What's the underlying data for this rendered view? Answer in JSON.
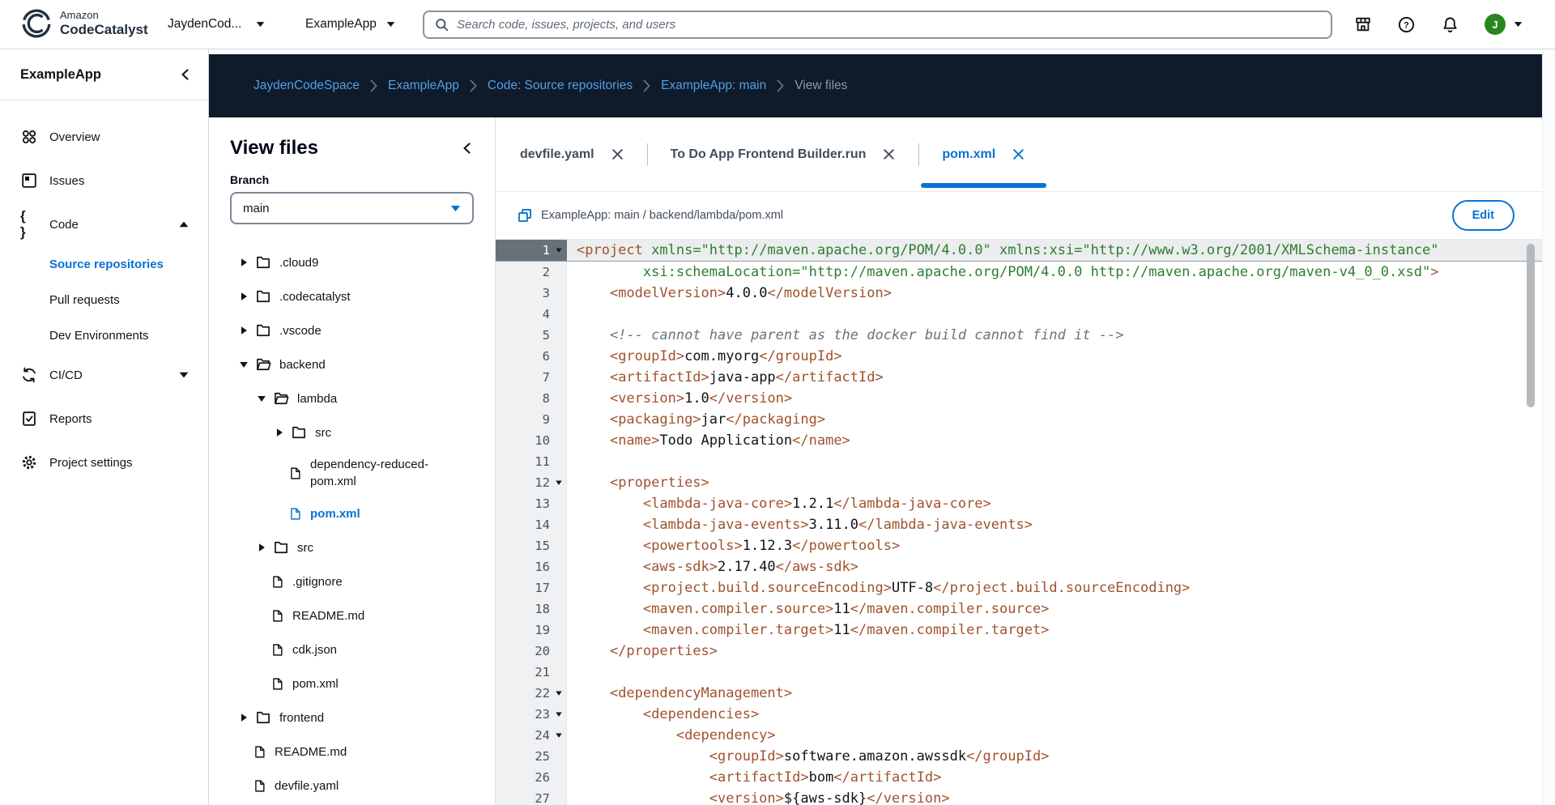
{
  "topbar": {
    "brand_small": "Amazon",
    "brand_bold": "CodeCatalyst",
    "space_selector": "JaydenCod...",
    "project_selector": "ExampleApp",
    "search_placeholder": "Search code, issues, projects, and users",
    "avatar_initial": "J"
  },
  "breadcrumb": {
    "links": [
      "JaydenCodeSpace",
      "ExampleApp",
      "Code: Source repositories",
      "ExampleApp: main"
    ],
    "current": "View files"
  },
  "sidebar": {
    "project_name": "ExampleApp",
    "items": [
      {
        "label": "Overview",
        "icon": "overview"
      },
      {
        "label": "Issues",
        "icon": "issues"
      },
      {
        "label": "Code",
        "icon": "code",
        "caret": "up"
      },
      {
        "label": "Source repositories",
        "sub": true,
        "active": true
      },
      {
        "label": "Pull requests",
        "sub": true
      },
      {
        "label": "Dev Environments",
        "sub": true
      },
      {
        "label": "CI/CD",
        "icon": "cicd",
        "caret": "down"
      },
      {
        "label": "Reports",
        "icon": "reports"
      },
      {
        "label": "Project settings",
        "icon": "settings"
      }
    ]
  },
  "file_tree": {
    "title": "View files",
    "branch_label": "Branch",
    "branch_value": "main",
    "items": [
      {
        "name": ".cloud9",
        "kind": "folder",
        "depth": 0
      },
      {
        "name": ".codecatalyst",
        "kind": "folder",
        "depth": 0
      },
      {
        "name": ".vscode",
        "kind": "folder",
        "depth": 0
      },
      {
        "name": "backend",
        "kind": "folder-open",
        "depth": 0
      },
      {
        "name": "lambda",
        "kind": "folder-open",
        "depth": 1
      },
      {
        "name": "src",
        "kind": "folder",
        "depth": 2
      },
      {
        "name": "dependency-reduced-pom.xml",
        "kind": "file",
        "depth": 2,
        "wrapped": true
      },
      {
        "name": "pom.xml",
        "kind": "file",
        "depth": 2,
        "selected": true
      },
      {
        "name": "src",
        "kind": "folder",
        "depth": 1
      },
      {
        "name": ".gitignore",
        "kind": "file",
        "depth": 1
      },
      {
        "name": "README.md",
        "kind": "file",
        "depth": 1
      },
      {
        "name": "cdk.json",
        "kind": "file",
        "depth": 1
      },
      {
        "name": "pom.xml",
        "kind": "file",
        "depth": 1
      },
      {
        "name": "frontend",
        "kind": "folder",
        "depth": 0
      },
      {
        "name": "README.md",
        "kind": "file",
        "depth": 0
      },
      {
        "name": "devfile.yaml",
        "kind": "file",
        "depth": 0
      }
    ]
  },
  "tabs": [
    {
      "label": "devfile.yaml",
      "active": false
    },
    {
      "label": "To Do App Frontend Builder.run",
      "active": false
    },
    {
      "label": "pom.xml",
      "active": true
    }
  ],
  "pathbar": {
    "path": "ExampleApp: main / backend/lambda/pom.xml",
    "edit_label": "Edit"
  },
  "editor": {
    "lines": [
      {
        "num": 1,
        "fold": true,
        "active": true,
        "tokens": [
          [
            "tag",
            "<project"
          ],
          [
            "txt",
            " "
          ],
          [
            "attr",
            "xmlns="
          ],
          [
            "str",
            "\"http://maven.apache.org/POM/4.0.0\""
          ],
          [
            "txt",
            " "
          ],
          [
            "attr",
            "xmlns:xsi="
          ],
          [
            "str",
            "\"http://www.w3.org/2001/XMLSchema-instance\""
          ]
        ]
      },
      {
        "num": 2,
        "tokens": [
          [
            "txt",
            "        "
          ],
          [
            "attr",
            "xsi:schemaLocation="
          ],
          [
            "str",
            "\"http://maven.apache.org/POM/4.0.0 http://maven.apache.org/maven-v4_0_0.xsd\""
          ],
          [
            "tag",
            ">"
          ]
        ]
      },
      {
        "num": 3,
        "tokens": [
          [
            "txt",
            "    "
          ],
          [
            "tag",
            "<modelVersion>"
          ],
          [
            "txt",
            "4.0.0"
          ],
          [
            "tag",
            "</modelVersion>"
          ]
        ]
      },
      {
        "num": 4,
        "tokens": []
      },
      {
        "num": 5,
        "tokens": [
          [
            "txt",
            "    "
          ],
          [
            "com",
            "<!-- cannot have parent as the docker build cannot find it -->"
          ]
        ]
      },
      {
        "num": 6,
        "tokens": [
          [
            "txt",
            "    "
          ],
          [
            "tag",
            "<groupId>"
          ],
          [
            "txt",
            "com.myorg"
          ],
          [
            "tag",
            "</groupId>"
          ]
        ]
      },
      {
        "num": 7,
        "tokens": [
          [
            "txt",
            "    "
          ],
          [
            "tag",
            "<artifactId>"
          ],
          [
            "txt",
            "java-app"
          ],
          [
            "tag",
            "</artifactId>"
          ]
        ]
      },
      {
        "num": 8,
        "tokens": [
          [
            "txt",
            "    "
          ],
          [
            "tag",
            "<version>"
          ],
          [
            "txt",
            "1.0"
          ],
          [
            "tag",
            "</version>"
          ]
        ]
      },
      {
        "num": 9,
        "tokens": [
          [
            "txt",
            "    "
          ],
          [
            "tag",
            "<packaging>"
          ],
          [
            "txt",
            "jar"
          ],
          [
            "tag",
            "</packaging>"
          ]
        ]
      },
      {
        "num": 10,
        "tokens": [
          [
            "txt",
            "    "
          ],
          [
            "tag",
            "<name>"
          ],
          [
            "txt",
            "Todo Application"
          ],
          [
            "tag",
            "</name>"
          ]
        ]
      },
      {
        "num": 11,
        "tokens": []
      },
      {
        "num": 12,
        "fold": true,
        "tokens": [
          [
            "txt",
            "    "
          ],
          [
            "tag",
            "<properties>"
          ]
        ]
      },
      {
        "num": 13,
        "tokens": [
          [
            "txt",
            "        "
          ],
          [
            "tag",
            "<lambda-java-core>"
          ],
          [
            "txt",
            "1.2.1"
          ],
          [
            "tag",
            "</lambda-java-core>"
          ]
        ]
      },
      {
        "num": 14,
        "tokens": [
          [
            "txt",
            "        "
          ],
          [
            "tag",
            "<lambda-java-events>"
          ],
          [
            "txt",
            "3.11.0"
          ],
          [
            "tag",
            "</lambda-java-events>"
          ]
        ]
      },
      {
        "num": 15,
        "tokens": [
          [
            "txt",
            "        "
          ],
          [
            "tag",
            "<powertools>"
          ],
          [
            "txt",
            "1.12.3"
          ],
          [
            "tag",
            "</powertools>"
          ]
        ]
      },
      {
        "num": 16,
        "tokens": [
          [
            "txt",
            "        "
          ],
          [
            "tag",
            "<aws-sdk>"
          ],
          [
            "txt",
            "2.17.40"
          ],
          [
            "tag",
            "</aws-sdk>"
          ]
        ]
      },
      {
        "num": 17,
        "tokens": [
          [
            "txt",
            "        "
          ],
          [
            "tag",
            "<project.build.sourceEncoding>"
          ],
          [
            "txt",
            "UTF-8"
          ],
          [
            "tag",
            "</project.build.sourceEncoding>"
          ]
        ]
      },
      {
        "num": 18,
        "tokens": [
          [
            "txt",
            "        "
          ],
          [
            "tag",
            "<maven.compiler.source>"
          ],
          [
            "txt",
            "11"
          ],
          [
            "tag",
            "</maven.compiler.source>"
          ]
        ]
      },
      {
        "num": 19,
        "tokens": [
          [
            "txt",
            "        "
          ],
          [
            "tag",
            "<maven.compiler.target>"
          ],
          [
            "txt",
            "11"
          ],
          [
            "tag",
            "</maven.compiler.target>"
          ]
        ]
      },
      {
        "num": 20,
        "tokens": [
          [
            "txt",
            "    "
          ],
          [
            "tag",
            "</properties>"
          ]
        ]
      },
      {
        "num": 21,
        "tokens": []
      },
      {
        "num": 22,
        "fold": true,
        "tokens": [
          [
            "txt",
            "    "
          ],
          [
            "tag",
            "<dependencyManagement>"
          ]
        ]
      },
      {
        "num": 23,
        "fold": true,
        "tokens": [
          [
            "txt",
            "        "
          ],
          [
            "tag",
            "<dependencies>"
          ]
        ]
      },
      {
        "num": 24,
        "fold": true,
        "tokens": [
          [
            "txt",
            "            "
          ],
          [
            "tag",
            "<dependency>"
          ]
        ]
      },
      {
        "num": 25,
        "tokens": [
          [
            "txt",
            "                "
          ],
          [
            "tag",
            "<groupId>"
          ],
          [
            "txt",
            "software.amazon.awssdk"
          ],
          [
            "tag",
            "</groupId>"
          ]
        ]
      },
      {
        "num": 26,
        "tokens": [
          [
            "txt",
            "                "
          ],
          [
            "tag",
            "<artifactId>"
          ],
          [
            "txt",
            "bom"
          ],
          [
            "tag",
            "</artifactId>"
          ]
        ]
      },
      {
        "num": 27,
        "tokens": [
          [
            "txt",
            "                "
          ],
          [
            "tag",
            "<version>"
          ],
          [
            "txt",
            "${aws-sdk}"
          ],
          [
            "tag",
            "</version>"
          ]
        ]
      }
    ]
  },
  "colors": {
    "accent_blue": "#0972d3",
    "breadcrumb_bg": "#0f1b2a",
    "breadcrumb_link": "#539fe5",
    "code_tag": "#a0522d",
    "code_string": "#2e7d32",
    "code_comment": "#6a737b",
    "avatar_green": "#2a8521"
  }
}
